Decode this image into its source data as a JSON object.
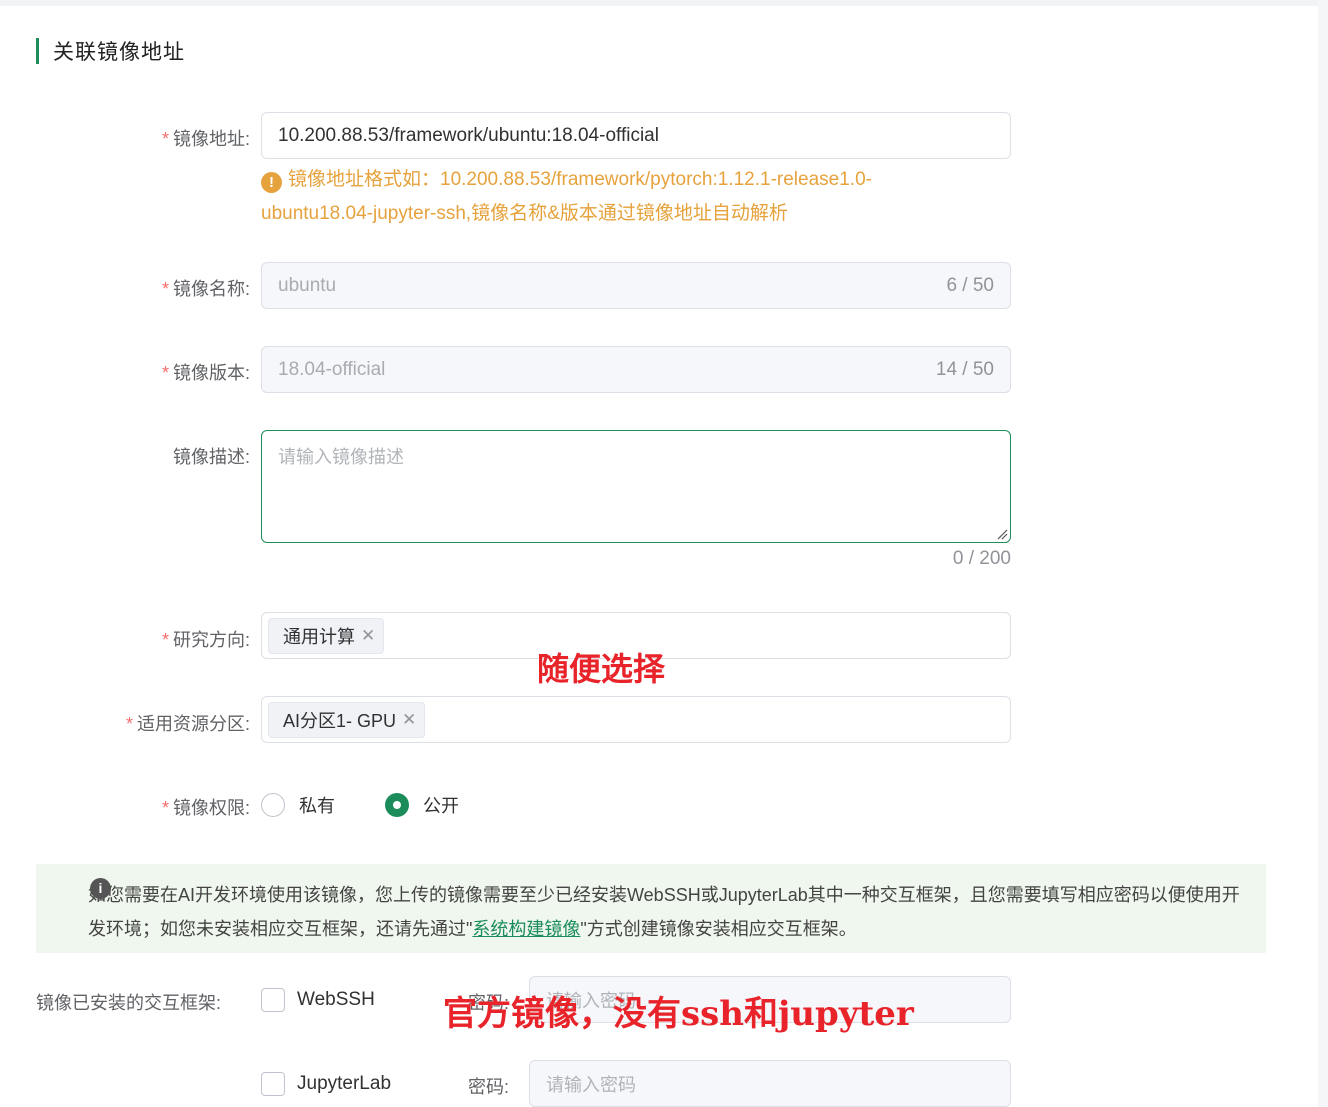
{
  "section": {
    "title": "关联镜像地址"
  },
  "image_address": {
    "label": "镜像地址:",
    "value": "10.200.88.53/framework/ubuntu:18.04-official",
    "hint_line1": "镜像地址格式如：10.200.88.53/framework/pytorch:1.12.1-release1.0-",
    "hint_line2": "ubuntu18.04-jupyter-ssh,镜像名称&版本通过镜像地址自动解析"
  },
  "image_name": {
    "label": "镜像名称:",
    "value": "ubuntu",
    "count": "6 / 50"
  },
  "image_version": {
    "label": "镜像版本:",
    "value": "18.04-official",
    "count": "14 / 50"
  },
  "image_desc": {
    "label": "镜像描述:",
    "placeholder": "请输入镜像描述",
    "count": "0 / 200"
  },
  "research": {
    "label": "研究方向:",
    "tag": "通用计算"
  },
  "resource": {
    "label": "适用资源分区:",
    "tag": "AI分区1- GPU"
  },
  "permission": {
    "label": "镜像权限:",
    "options": [
      "私有",
      "公开"
    ],
    "selected": "公开"
  },
  "notice": {
    "text_before": "如您需要在AI开发环境使用该镜像，您上传的镜像需要至少已经安装WebSSH或JupyterLab其中一种交互框架，且您需要填写相应密码以便使用开发环境；如您未安装相应交互框架，还请先通过\"",
    "link": "系统构建镜像",
    "text_after": "\"方式创建镜像安装相应交互框架。"
  },
  "frameworks": {
    "label": "镜像已安装的交互框架:",
    "items": [
      {
        "name": "WebSSH",
        "password_label": "密码:",
        "password_placeholder": "请输入密码"
      },
      {
        "name": "JupyterLab",
        "password_label": "密码:",
        "password_placeholder": "请输入密码"
      }
    ]
  },
  "annotations": {
    "random_select": "随便选择",
    "official_note": "官方镜像，没有ssh和jupyter"
  },
  "colors": {
    "primary": "#1b8c5a",
    "warning": "#e6a23c",
    "required": "#f56c6c",
    "annotation": "#e8232a"
  }
}
